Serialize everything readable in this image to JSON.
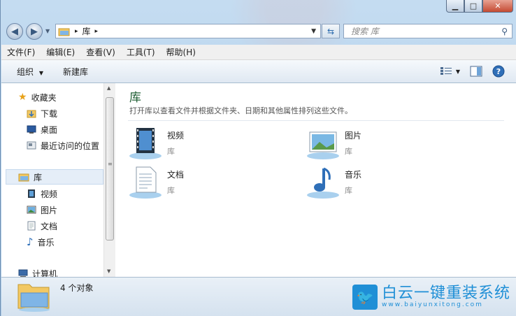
{
  "window": {
    "min_glyph": "▁",
    "max_glyph": "□",
    "close_glyph": "✕"
  },
  "address": {
    "path": [
      "库"
    ],
    "sep": "▸"
  },
  "search": {
    "placeholder": "搜索 库"
  },
  "menu": [
    "文件(F)",
    "编辑(E)",
    "查看(V)",
    "工具(T)",
    "帮助(H)"
  ],
  "toolbar": {
    "organize": "组织",
    "new_library": "新建库"
  },
  "nav": {
    "favorites": {
      "label": "收藏夹",
      "items": [
        "下载",
        "桌面",
        "最近访问的位置"
      ]
    },
    "libraries": {
      "label": "库",
      "items": [
        "视频",
        "图片",
        "文档",
        "音乐"
      ]
    },
    "computer": {
      "label": "计算机"
    }
  },
  "main": {
    "title": "库",
    "subtitle": "打开库以查看文件并根据文件夹、日期和其他属性排列这些文件。",
    "libraries": [
      {
        "name": "视频",
        "type": "库",
        "icon": "video-library-icon"
      },
      {
        "name": "图片",
        "type": "库",
        "icon": "pictures-library-icon"
      },
      {
        "name": "文档",
        "type": "库",
        "icon": "documents-library-icon"
      },
      {
        "name": "音乐",
        "type": "库",
        "icon": "music-library-icon"
      }
    ]
  },
  "status": {
    "count": "4 个对象"
  },
  "watermark": {
    "brand": "白云一键重装系统",
    "url": "www.baiyunxitong.com"
  },
  "colors": {
    "title_green": "#1e5e33",
    "accent_blue": "#1f8fd6"
  }
}
